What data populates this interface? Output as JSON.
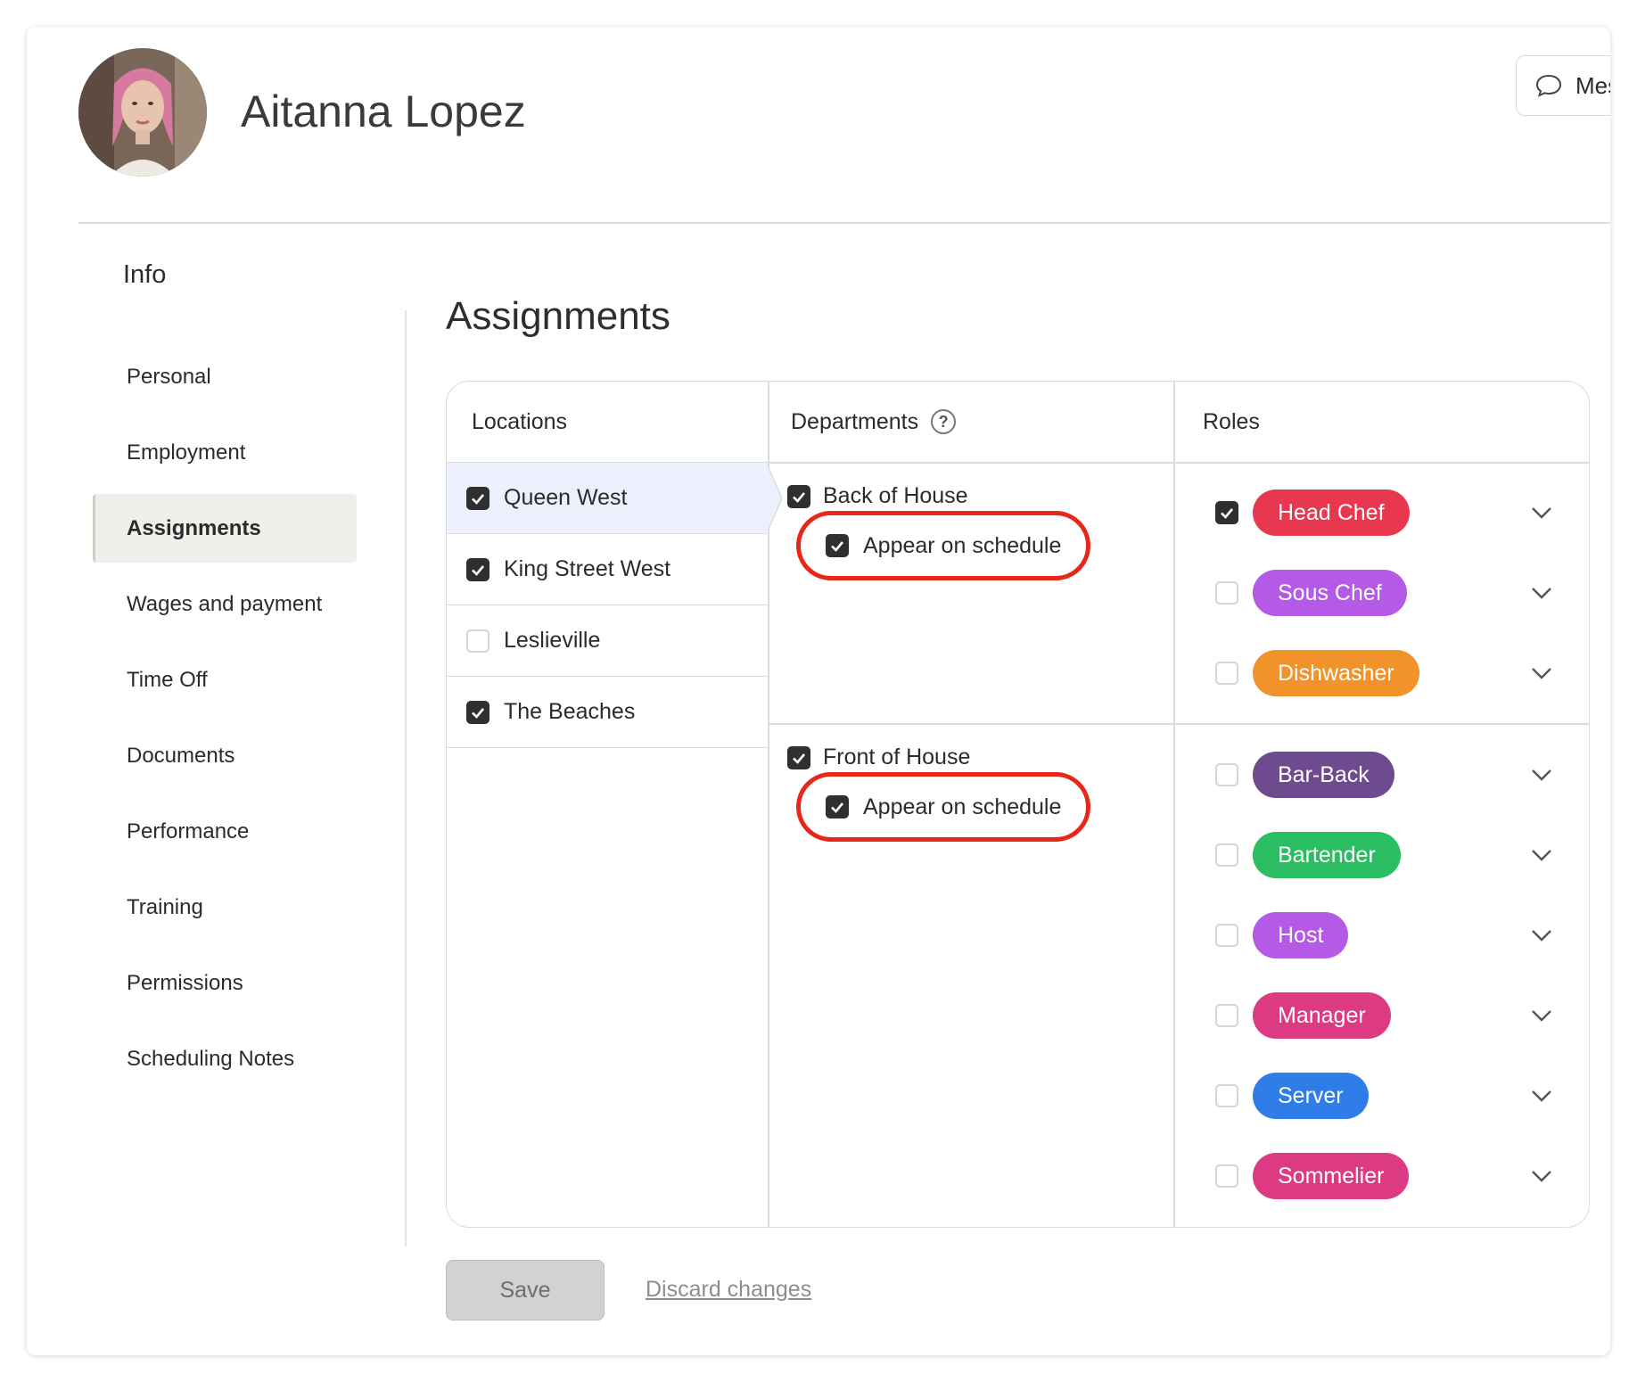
{
  "profile": {
    "name": "Aitanna Lopez",
    "message_button": "Mes"
  },
  "sidebar": {
    "heading": "Info",
    "items": [
      {
        "label": "Personal"
      },
      {
        "label": "Employment"
      },
      {
        "label": "Assignments",
        "active": true
      },
      {
        "label": "Wages and payment"
      },
      {
        "label": "Time Off"
      },
      {
        "label": "Documents"
      },
      {
        "label": "Performance"
      },
      {
        "label": "Training"
      },
      {
        "label": "Permissions"
      },
      {
        "label": "Scheduling Notes"
      }
    ]
  },
  "assignments": {
    "title": "Assignments",
    "columns": {
      "locations": "Locations",
      "departments": "Departments",
      "roles": "Roles"
    },
    "locations": [
      {
        "label": "Queen West",
        "checked": true,
        "selected": true
      },
      {
        "label": "King Street West",
        "checked": true
      },
      {
        "label": "Leslieville",
        "checked": false
      },
      {
        "label": "The Beaches",
        "checked": true
      }
    ],
    "departments": [
      {
        "label": "Back of House",
        "checked": true,
        "appear_label": "Appear on schedule",
        "appear_checked": true
      },
      {
        "label": "Front of House",
        "checked": true,
        "appear_label": "Appear on schedule",
        "appear_checked": true
      }
    ],
    "roles": [
      {
        "label": "Head Chef",
        "checked": true,
        "color": "#e8384f"
      },
      {
        "label": "Sous Chef",
        "checked": false,
        "color": "#b55ae6"
      },
      {
        "label": "Dishwasher",
        "checked": false,
        "color": "#f2922a"
      },
      {
        "label": "Bar-Back",
        "checked": false,
        "color": "#6e4a8e"
      },
      {
        "label": "Bartender",
        "checked": false,
        "color": "#2bbd62"
      },
      {
        "label": "Host",
        "checked": false,
        "color": "#b55ae6"
      },
      {
        "label": "Manager",
        "checked": false,
        "color": "#dc3a82"
      },
      {
        "label": "Server",
        "checked": false,
        "color": "#2f7de8"
      },
      {
        "label": "Sommelier",
        "checked": false,
        "color": "#dc3a82"
      }
    ]
  },
  "actions": {
    "save": "Save",
    "discard": "Discard changes"
  }
}
